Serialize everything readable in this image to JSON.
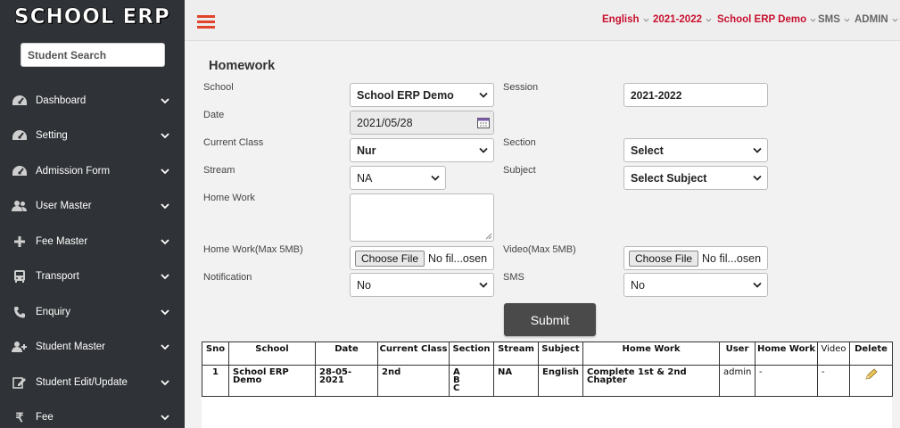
{
  "app": {
    "logo": "SCHOOL ERP",
    "search_placeholder": "Student Search"
  },
  "sidebar": {
    "items": [
      {
        "label": "Dashboard",
        "icon": "dashboard-icon"
      },
      {
        "label": "Setting",
        "icon": "dashboard-icon"
      },
      {
        "label": "Admission Form",
        "icon": "dashboard-icon"
      },
      {
        "label": "User Master",
        "icon": "users-icon"
      },
      {
        "label": "Fee Master",
        "icon": "plus-icon"
      },
      {
        "label": "Transport",
        "icon": "bus-icon"
      },
      {
        "label": "Enquiry",
        "icon": "phone-icon"
      },
      {
        "label": "Student Master",
        "icon": "user-plus-icon"
      },
      {
        "label": "Student Edit/Update",
        "icon": "edit-icon"
      },
      {
        "label": "Fee",
        "icon": "rupee-icon"
      }
    ]
  },
  "topbar": {
    "language": "English",
    "session": "2021-2022",
    "school": "School ERP Demo",
    "sms": "SMS",
    "admin": "ADMIN"
  },
  "form": {
    "title": "Homework",
    "school_label": "School",
    "school_value": "School ERP Demo",
    "session_label": "Session",
    "session_value": "2021-2022",
    "date_label": "Date",
    "date_value": "2021/05/28",
    "class_label": "Current Class",
    "class_value": "Nur",
    "section_label": "Section",
    "section_value": "Select",
    "stream_label": "Stream",
    "stream_value": "NA",
    "subject_label": "Subject",
    "subject_value": "Select Subject",
    "homework_label": "Home Work",
    "homework_file_label": "Home Work(Max 5MB)",
    "video_label": "Video(Max 5MB)",
    "choose_file": "Choose File",
    "no_file": "No fil...osen",
    "notification_label": "Notification",
    "notification_value": "No",
    "sms_label": "SMS",
    "sms_value": "No",
    "submit": "Submit"
  },
  "table": {
    "headers": [
      "Sno",
      "School",
      "Date",
      "Current Class",
      "Section",
      "Stream",
      "Subject",
      "Home Work",
      "User",
      "Home Work",
      "Video",
      "Delete"
    ],
    "rows": [
      {
        "sno": "1",
        "school": "School ERP Demo",
        "date": "28-05-2021",
        "class": "2nd",
        "section": "A B C",
        "stream": "NA",
        "subject": "English",
        "homework": "Complete 1st & 2nd Chapter",
        "user": "admin",
        "home_work": "-",
        "video": "-"
      }
    ]
  },
  "colors": {
    "sidebar_bg": "#2f3236",
    "accent_red": "#c8102e",
    "hamburger": "#e0442a",
    "submit_bg": "#4a4a4a"
  }
}
